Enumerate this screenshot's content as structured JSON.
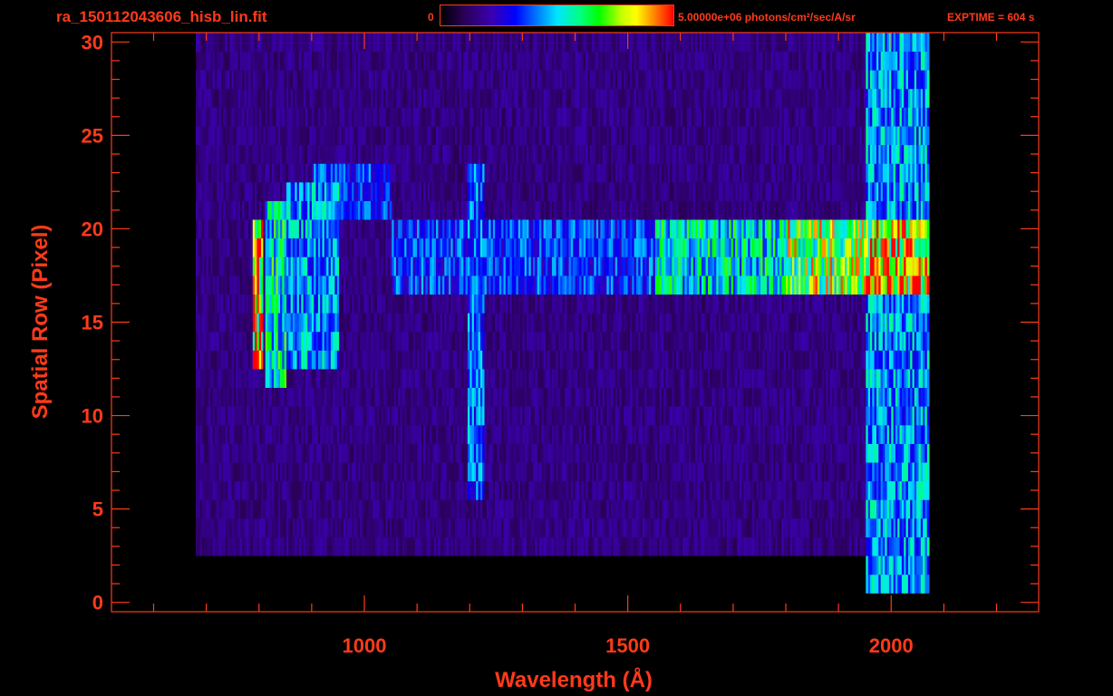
{
  "header": {
    "file_title": "ra_150112043606_hisb_lin.fit",
    "colorbar_min": "0",
    "colorbar_max": "5.00000e+06 photons/cm²/sec/A/sr",
    "exptime": "EXPTIME = 604 s"
  },
  "colors": {
    "background": "#000000",
    "axis": "#ff3a1a"
  },
  "chart_data": {
    "type": "heatmap",
    "colormap": "rainbow",
    "colormap_range": [
      0,
      5000000
    ],
    "xlabel": "Wavelength (Å)",
    "ylabel": "Spatial Row (Pixel)",
    "xlim": [
      520,
      2280
    ],
    "ylim": [
      -0.5,
      30.5
    ],
    "xticks": [
      1000,
      1500,
      2000
    ],
    "xtick_labels": [
      "1000",
      "1500",
      "2000"
    ],
    "yticks": [
      0,
      5,
      10,
      15,
      20,
      25,
      30
    ],
    "ytick_labels": [
      "0",
      "5",
      "10",
      "15",
      "20",
      "25",
      "30"
    ],
    "grid": false,
    "features": [
      {
        "row_min": 3,
        "row_max": 30,
        "x_min": 680,
        "x_max": 2070,
        "level": 0.18
      },
      {
        "row_min": 13,
        "row_max": 20,
        "x_min": 785,
        "x_max": 805,
        "level": 0.97
      },
      {
        "row_min": 12,
        "row_max": 21,
        "x_min": 810,
        "x_max": 850,
        "level": 0.62
      },
      {
        "row_min": 13,
        "row_max": 22,
        "x_min": 850,
        "x_max": 950,
        "level": 0.5
      },
      {
        "row_min": 21,
        "row_max": 23,
        "x_min": 900,
        "x_max": 1050,
        "level": 0.4
      },
      {
        "row_min": 6,
        "row_max": 23,
        "x_min": 1195,
        "x_max": 1225,
        "level": 0.45
      },
      {
        "row_min": 17,
        "row_max": 20,
        "x_min": 1050,
        "x_max": 1550,
        "level": 0.4
      },
      {
        "row_min": 17,
        "row_max": 20,
        "x_min": 1550,
        "x_max": 1800,
        "level": 0.6
      },
      {
        "row_min": 17,
        "row_max": 20,
        "x_min": 1800,
        "x_max": 1950,
        "level": 0.82
      },
      {
        "row_min": 17,
        "row_max": 20,
        "x_min": 1950,
        "x_max": 2070,
        "level": 0.93
      },
      {
        "row_min": 1,
        "row_max": 30,
        "x_min": 1950,
        "x_max": 2070,
        "level": 0.5
      }
    ]
  }
}
